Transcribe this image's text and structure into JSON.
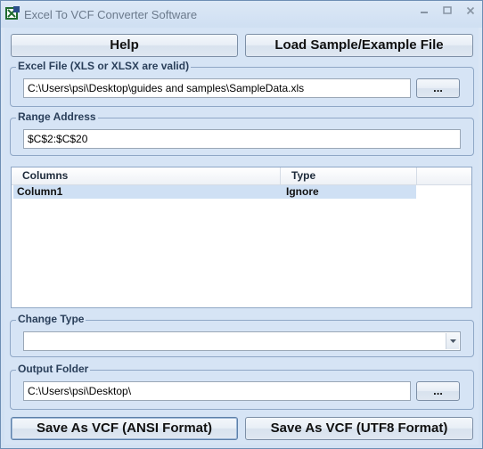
{
  "window": {
    "title": "Excel To VCF Converter Software",
    "controls": {
      "minimize_icon": "minimize-icon",
      "maximize_icon": "maximize-icon",
      "close_icon": "close-icon"
    }
  },
  "toolbar": {
    "help_label": "Help",
    "load_sample_label": "Load Sample/Example File"
  },
  "excel_file": {
    "group_label": "Excel File (XLS or XLSX are valid)",
    "value": "C:\\Users\\psi\\Desktop\\guides and samples\\SampleData.xls",
    "browse_label": "..."
  },
  "range_address": {
    "group_label": "Range Address",
    "value": "$C$2:$C$20"
  },
  "columns_list": {
    "headers": [
      "Columns",
      "Type"
    ],
    "rows": [
      {
        "column": "Column1",
        "type": "Ignore"
      }
    ]
  },
  "change_type": {
    "group_label": "Change Type",
    "selected": ""
  },
  "output_folder": {
    "group_label": "Output Folder",
    "value": "C:\\Users\\psi\\Desktop\\",
    "browse_label": "..."
  },
  "actions": {
    "save_ansi_label": "Save As VCF (ANSI Format)",
    "save_utf8_label": "Save As VCF (UTF8 Format)"
  },
  "colors": {
    "window_bg": "#d6e4f5",
    "group_border": "#8fa7c6",
    "selected_row": "#cfe0f4"
  }
}
